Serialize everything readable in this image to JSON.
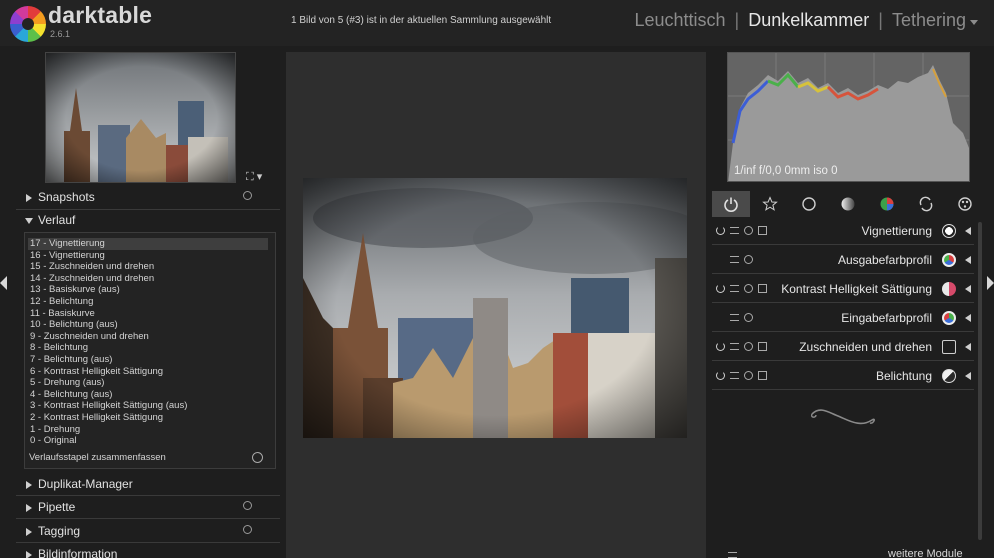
{
  "app": {
    "name": "darktable",
    "version": "2.6.1"
  },
  "header": {
    "selection_status": "1 Bild von 5 (#3) ist in der aktuellen Sammlung ausgewählt",
    "views": {
      "lighttable": "Leuchttisch",
      "darkroom": "Dunkelkammer",
      "tethering": "Tethering"
    },
    "separator": "|"
  },
  "left_panel": {
    "sections": {
      "snapshots": "Snapshots",
      "history": "Verlauf",
      "duplicate": "Duplikat-Manager",
      "pipette": "Pipette",
      "tagging": "Tagging",
      "image_info": "Bildinformation"
    },
    "history": {
      "items": [
        "17 - Vignettierung",
        "16 - Vignettierung",
        "15 - Zuschneiden und drehen",
        "14 - Zuschneiden und drehen",
        "13 - Basiskurve (aus)",
        "12 - Belichtung",
        "11 - Basiskurve",
        "10 - Belichtung (aus)",
        "9 - Zuschneiden und drehen",
        "8 - Belichtung",
        "7 - Belichtung (aus)",
        "6 - Kontrast Helligkeit Sättigung",
        "5 - Drehung (aus)",
        "4 - Belichtung (aus)",
        "3 - Kontrast Helligkeit Sättigung (aus)",
        "2 - Kontrast Helligkeit Sättigung",
        "1 - Drehung",
        "0 - Original"
      ],
      "selected_index": 0,
      "compress_label": "Verlaufsstapel zusammenfassen"
    }
  },
  "histogram": {
    "info": "1/inf f/0,0 0mm iso 0"
  },
  "modules": [
    {
      "name": "Vignettierung",
      "icon": "vignette-icon",
      "has_power": true,
      "icon_color": "#e8e8e8"
    },
    {
      "name": "Ausgabefarbprofil",
      "icon": "output-profile-icon",
      "has_power": false,
      "icon_color": "#5aa84a"
    },
    {
      "name": "Kontrast Helligkeit Sättigung",
      "icon": "color-balance-icon",
      "has_power": true,
      "icon_color": "#d64a6a"
    },
    {
      "name": "Eingabefarbprofil",
      "icon": "input-profile-icon",
      "has_power": false,
      "icon_color": "#4a8ad6"
    },
    {
      "name": "Zuschneiden und drehen",
      "icon": "crop-icon",
      "has_power": true,
      "icon_color": "#cfcfcf"
    },
    {
      "name": "Belichtung",
      "icon": "exposure-icon",
      "has_power": true,
      "icon_color": "#e8e8e8"
    }
  ],
  "right_footer": {
    "more_modules": "weitere Module"
  },
  "colors": {
    "background": "#1e1e1e",
    "panel": "#232323",
    "center": "#2e2e2e",
    "histogram": "#646464"
  }
}
